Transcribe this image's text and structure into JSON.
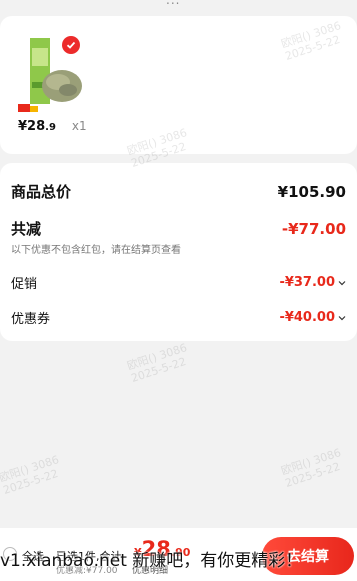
{
  "top_hint": "...",
  "product": {
    "price_main": "¥28",
    "price_decimal": ".9",
    "quantity": "x1"
  },
  "summary": {
    "total_label": "商品总价",
    "total_value": "¥105.90",
    "discount_label": "共减",
    "discount_value": "-¥77.00",
    "discount_note": "以下优惠不包含红包，请在结算页查看",
    "promo_label": "促销",
    "promo_value": "-¥37.00",
    "coupon_label": "优惠券",
    "coupon_value": "-¥40.00"
  },
  "watermark": {
    "line1": "欧阳() 3086",
    "line2": "2025-5-22"
  },
  "bottom": {
    "select_all": "全选",
    "selected_info": "已选1件,合计",
    "total_yen": "¥",
    "total_big": "28",
    "total_dec": ".90",
    "discount_line": "优惠减:¥77.00",
    "discount_detail": "优惠明细",
    "checkout": "去结算"
  },
  "overlay_banner": "v1.xianbao.net 新赚吧，有你更精彩！",
  "colors": {
    "accent_red": "#e8291b",
    "background": "#f2f2f2"
  }
}
